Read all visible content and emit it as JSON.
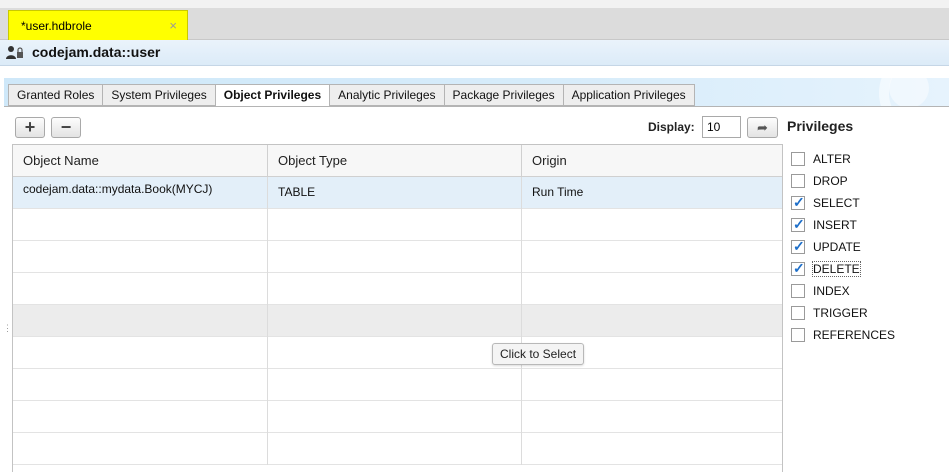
{
  "editor_tab": {
    "label": "*user.hdbrole",
    "close_glyph": "×"
  },
  "header": {
    "title": "codejam.data::user",
    "icon": "user-lock-icon"
  },
  "subtabs": [
    {
      "label": "Granted Roles",
      "active": false
    },
    {
      "label": "System Privileges",
      "active": false
    },
    {
      "label": "Object Privileges",
      "active": true
    },
    {
      "label": "Analytic Privileges",
      "active": false
    },
    {
      "label": "Package Privileges",
      "active": false
    },
    {
      "label": "Application Privileges",
      "active": false
    }
  ],
  "toolbar": {
    "add_glyph": "+",
    "remove_glyph": "−",
    "display_label": "Display:",
    "display_value": "10",
    "go_icon": "arrow-right-icon"
  },
  "grid": {
    "columns": [
      "Object Name",
      "Object Type",
      "Origin"
    ],
    "rows": [
      [
        "codejam.data::mydata.Book(MYCJ)",
        "TABLE",
        "Run Time"
      ],
      [
        "",
        "",
        ""
      ],
      [
        "",
        "",
        ""
      ],
      [
        "",
        "",
        ""
      ],
      [
        "",
        "",
        ""
      ],
      [
        "",
        "",
        ""
      ],
      [
        "",
        "",
        ""
      ],
      [
        "",
        "",
        ""
      ],
      [
        "",
        "",
        ""
      ]
    ],
    "tooltip": "Click to Select"
  },
  "privileges": {
    "title": "Privileges",
    "items": [
      {
        "label": "ALTER",
        "checked": false
      },
      {
        "label": "DROP",
        "checked": false
      },
      {
        "label": "SELECT",
        "checked": true
      },
      {
        "label": "INSERT",
        "checked": true
      },
      {
        "label": "UPDATE",
        "checked": true
      },
      {
        "label": "DELETE",
        "checked": true
      },
      {
        "label": "INDEX",
        "checked": false
      },
      {
        "label": "TRIGGER",
        "checked": false
      },
      {
        "label": "REFERENCES",
        "checked": false
      }
    ]
  },
  "colors": {
    "editor_tab_bg": "#ffff00",
    "header_bar": "#dcebf8",
    "selected_row": "#e3eff9",
    "checkmark": "#1e6fc9"
  }
}
